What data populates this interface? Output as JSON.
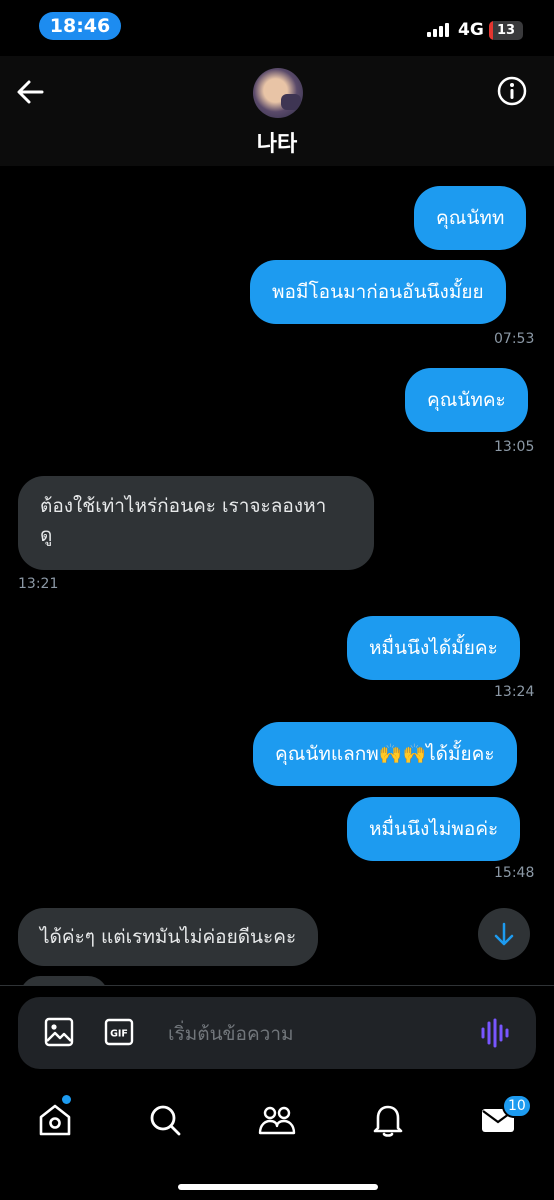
{
  "status": {
    "time": "18:46",
    "network": "4G",
    "battery": "13",
    "battery_level": 0.13
  },
  "header": {
    "contact_name": "나타"
  },
  "messages": [
    {
      "text": "คุณนัทท",
      "direction": "sent"
    },
    {
      "text": "พอมีโอนมาก่อนอันนึงมั้ยย",
      "direction": "sent",
      "time": "07:53"
    },
    {
      "text": "คุณนัทคะ",
      "direction": "sent",
      "time": "13:05"
    },
    {
      "text_line1": "ต้องใช้เท่าไหร่ก่อนคะ เราจะลองหา",
      "text_line2": "ดู",
      "direction": "received",
      "time": "13:21"
    },
    {
      "text": "หมื่นนึงได้มั้ยคะ",
      "direction": "sent",
      "time": "13:24"
    },
    {
      "text_before": "คุณนัทแลกพ",
      "emoji": "🙌🙌",
      "text_after": "ได้มั้ยคะ",
      "direction": "sent"
    },
    {
      "text": "หมื่นนึงไม่พอค่ะ",
      "direction": "sent",
      "time": "15:48"
    },
    {
      "text": "ได้ค่ะๆ แต่เรทมันไม่ค่อยดีนะคะ",
      "direction": "received"
    }
  ],
  "composer": {
    "placeholder": "เริ่มต้นข้อความ",
    "gif_label": "GIF"
  },
  "tabbar": {
    "messages_badge": "10"
  },
  "colors": {
    "sent_bubble": "#1d9bf0",
    "received_bubble": "#2f3336",
    "accent": "#1d9bf0",
    "voice": "#7856ff"
  }
}
